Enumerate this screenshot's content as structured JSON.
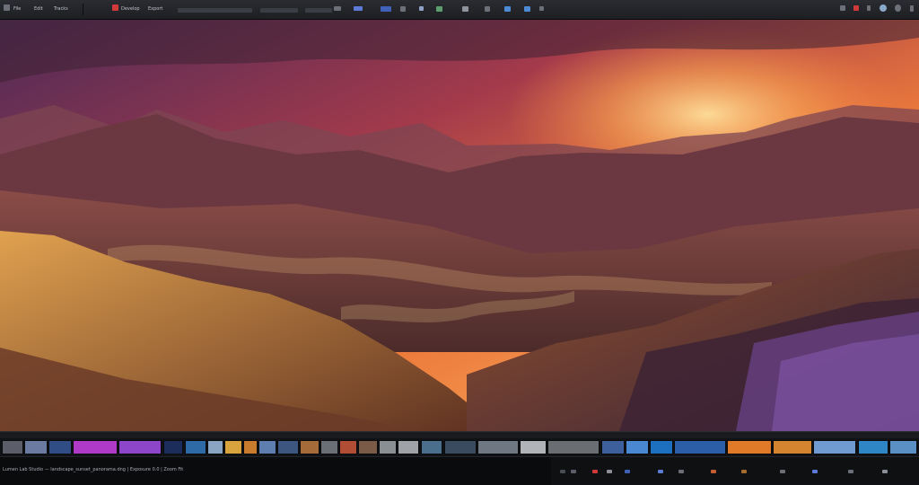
{
  "toolbar": {
    "items": [
      {
        "label": "File",
        "name": "menu-file"
      },
      {
        "label": "Edit",
        "name": "menu-edit"
      },
      {
        "label": "Tracks",
        "name": "menu-tracks"
      },
      {
        "label": "Develop",
        "name": "menu-develop"
      },
      {
        "label": "Export",
        "name": "menu-export"
      }
    ],
    "accent_color": "#5c7ad6",
    "record_color": "#d23a3a"
  },
  "status": {
    "text": "Lumen Lab Studio — landscape_sunset_panorama.dng  |  Exposure 0.0  |  Zoom Fit"
  },
  "filmstrip": {
    "thumb_colors": [
      "#5b5e68",
      "#6a7aa0",
      "#304d86",
      "#b03ac8",
      "#8d45c9",
      "#1c2d5c",
      "#2e6aa5",
      "#8aa5c4",
      "#d9a43d",
      "#c97b2d",
      "#5f7eb0",
      "#3d5680",
      "#a56c3a",
      "#6a6e75",
      "#b24d35",
      "#7a5b48",
      "#8a8f93",
      "#9fa3a8",
      "#4a6f8c",
      "#3b4b5f",
      "#6f7882",
      "#b0b4b8",
      "#6a6d72",
      "#3d5f9c",
      "#4a88d1",
      "#1d6fbf",
      "#2b5ea6",
      "#e07a29",
      "#d4832e",
      "#6f9bd0",
      "#2f86c4",
      "#5a90c4"
    ]
  }
}
